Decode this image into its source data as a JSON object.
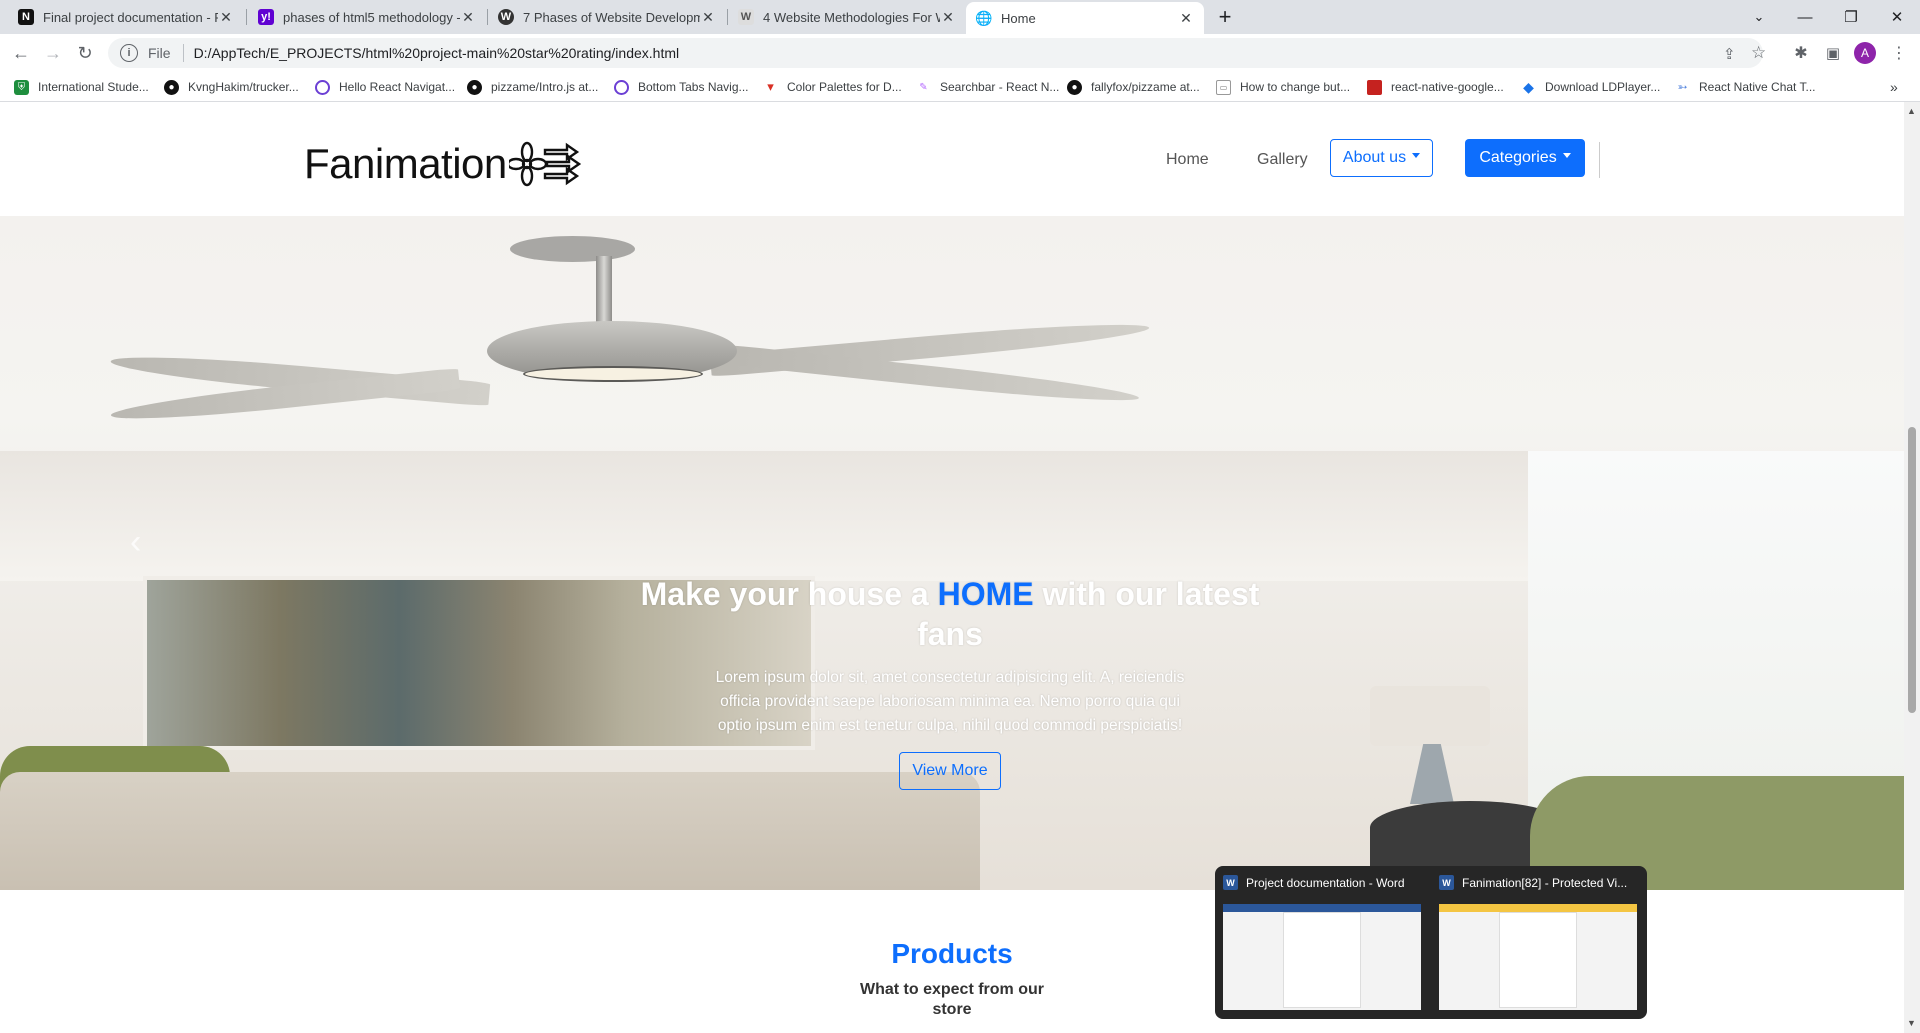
{
  "browser": {
    "tabs": [
      {
        "title": "Final project documentation - Pr",
        "icon": "notion-icon",
        "active": false
      },
      {
        "title": "phases of html5 methodology - Y",
        "icon": "yahoo-icon",
        "active": false
      },
      {
        "title": "7 Phases of Website Developmen",
        "icon": "wordpress-icon",
        "active": false
      },
      {
        "title": "4 Website Methodologies For We",
        "icon": "w-icon",
        "active": false
      },
      {
        "title": "Home",
        "icon": "globe-icon",
        "active": true
      }
    ],
    "scheme": "File",
    "url": "D:/AppTech/E_PROJECTS/html%20project-main%20star%20rating/index.html",
    "profile_initial": "A",
    "bookmarks": [
      "International Stude...",
      "KvngHakim/trucker...",
      "Hello React Navigat...",
      "pizzame/Intro.js at...",
      "Bottom Tabs Navig...",
      "Color Palettes for D...",
      "Searchbar - React N...",
      "fallyfox/pizzame at...",
      "How to change but...",
      "react-native-google...",
      "Download LDPlayer...",
      "React Native Chat T..."
    ]
  },
  "site": {
    "brand": "Fanimation",
    "nav": {
      "home": "Home",
      "gallery": "Gallery",
      "about": "About us",
      "categories": "Categories"
    },
    "hero": {
      "title_before": "Make your house a ",
      "title_highlight": "HOME",
      "title_after": " with our latest fans",
      "text": "Lorem ipsum dolor sit, amet consectetur adipisicing elit. A, reiciendis officia provident saepe laboriosam minima ea. Nemo porro quia qui optio ipsum enim est tenetur culpa, nihil quod commodi perspiciatis!",
      "button": "View More",
      "prev_glyph": "‹"
    },
    "products": {
      "heading": "Products",
      "subheading": "What to expect from our store"
    },
    "colors": {
      "accent": "#0d6efd"
    }
  },
  "taskbar_preview": [
    {
      "title": "Project documentation - Word",
      "icon": "word-icon"
    },
    {
      "title": "Fanimation[82] - Protected Vi...",
      "icon": "word-icon"
    }
  ]
}
